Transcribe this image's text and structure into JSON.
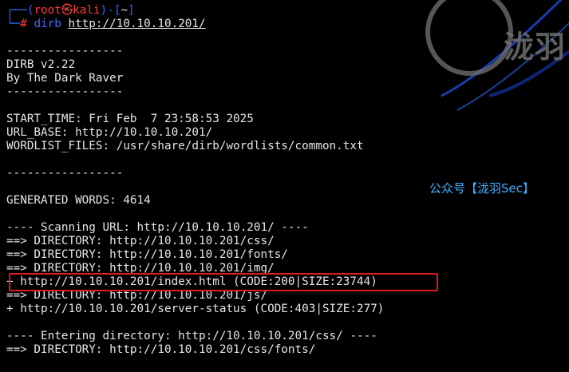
{
  "prompt": {
    "user": "root",
    "at_symbol": "㉿",
    "host": "kali",
    "dir": "~",
    "hash": "#",
    "command": "dirb",
    "argument": "http://10.10.10.201/"
  },
  "output_lines": [
    "",
    "-----------------",
    "DIRB v2.22",
    "By The Dark Raver",
    "-----------------",
    "",
    "START_TIME: Fri Feb  7 23:58:53 2025",
    "URL_BASE: http://10.10.10.201/",
    "WORDLIST_FILES: /usr/share/dirb/wordlists/common.txt",
    "",
    "-----------------",
    "",
    "GENERATED WORDS: 4614",
    "",
    "---- Scanning URL: http://10.10.10.201/ ----",
    "==> DIRECTORY: http://10.10.10.201/css/",
    "==> DIRECTORY: http://10.10.10.201/fonts/",
    "==> DIRECTORY: http://10.10.10.201/img/",
    "+ http://10.10.10.201/index.html (CODE:200|SIZE:23744)",
    "==> DIRECTORY: http://10.10.10.201/js/",
    "+ http://10.10.10.201/server-status (CODE:403|SIZE:277)",
    "",
    "---- Entering directory: http://10.10.10.201/css/ ----",
    "==> DIRECTORY: http://10.10.10.201/css/fonts/"
  ],
  "watermark": {
    "text": "泷羽",
    "caption": "公众号【泷羽Sec】"
  },
  "colors": {
    "background": "#000000",
    "text": "#e6e6e6",
    "prompt_frame": "#2f6bff",
    "prompt_user": "#ff3b3b",
    "highlight_border": "#e01b1b",
    "caption": "#3fb0ff"
  }
}
